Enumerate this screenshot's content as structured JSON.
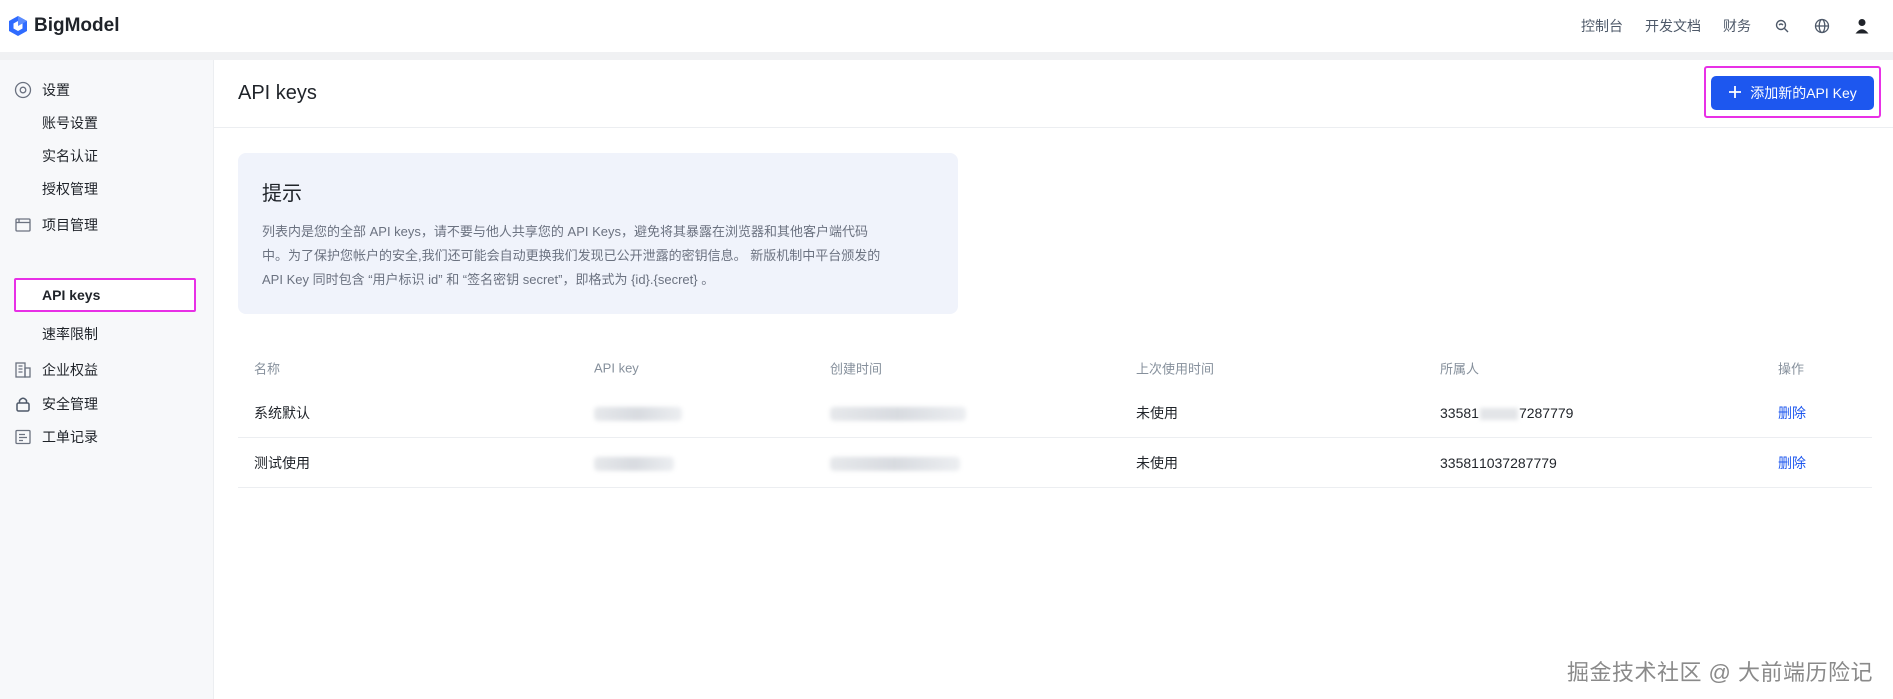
{
  "app": {
    "name": "BigModel"
  },
  "topnav": {
    "items": [
      "控制台",
      "开发文档",
      "财务"
    ]
  },
  "sidebar": {
    "groups": [
      {
        "label": "设置",
        "icon": "gear-icon"
      },
      {
        "label": "项目管理",
        "icon": "folder-icon"
      },
      {
        "label": "企业权益",
        "icon": "building-icon"
      },
      {
        "label": "安全管理",
        "icon": "lock-icon"
      },
      {
        "label": "工单记录",
        "icon": "ticket-icon"
      }
    ],
    "items": {
      "account": "账号设置",
      "realname": "实名认证",
      "auth": "授权管理",
      "apikeys": "API keys",
      "ratelimit": "速率限制"
    }
  },
  "main": {
    "title": "API keys",
    "add_button": "添加新的API Key",
    "tip": {
      "title": "提示",
      "line1": "列表内是您的全部 API keys，请不要与他人共享您的 API Keys，避免将其暴露在浏览器和其他客户端代码",
      "line2": "中。为了保护您帐户的安全,我们还可能会自动更换我们发现已公开泄露的密钥信息。 新版机制中平台颁发的",
      "line3": "API Key 同时包含 “用户标识 id” 和 “签名密钥 secret”，即格式为 {id}.{secret} 。"
    },
    "table": {
      "headers": [
        "名称",
        "API key",
        "创建时间",
        "上次使用时间",
        "所属人",
        "操作"
      ],
      "rows": [
        {
          "name": "系统默认",
          "last_used": "未使用",
          "owner_prefix": "33581",
          "owner_suffix": "7287779",
          "action": "删除"
        },
        {
          "name": "测试使用",
          "last_used": "未使用",
          "owner_prefix": "33581",
          "owner_suffix": "1037287779",
          "action": "删除"
        }
      ]
    }
  },
  "watermark": "掘金技术社区 @ 大前端历险记",
  "colors": {
    "primary": "#1d57ef",
    "highlight": "#e830e6",
    "sidebar_bg": "#f7f8fa",
    "tip_bg": "#f0f3fb"
  }
}
